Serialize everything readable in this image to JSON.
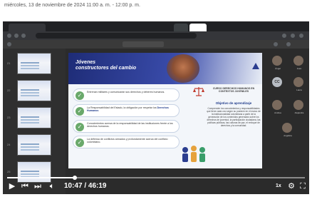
{
  "document": {
    "date_line": "miércoles, 13 de noviembre de 2024 11:00 a. m. - 12:00 p. m."
  },
  "player": {
    "progress_fraction": 0.228,
    "current_time": "10:47",
    "duration": "46:19",
    "time_separator": " / ",
    "speed": "1x"
  },
  "slide": {
    "title_line1": "Jóvenes",
    "title_line2": "constructores del cambio",
    "bullets": [
      {
        "text": "Entrenan militares y comunicarán sus derechos y deberes humanos.",
        "highlight": ""
      },
      {
        "text": "La Responsabilidad del Estado, la obligación por respetar los",
        "highlight": "Derechos Humanos"
      },
      {
        "text": "Conocimientos acerca de la responsabilidad de las instituciones frente a los derechos humanos.",
        "highlight": ""
      },
      {
        "text": "La defensa de conflictos armados y profundamente acerca del conflicto colombiano.",
        "highlight": ""
      }
    ],
    "right_panel": {
      "title": "CURSO DERECHOS HUMANOS EN CONTEXTOS JUVENILES",
      "subtitle": "Objetivo de aprendizaje",
      "body": "Comprender los conocimientos y responsabilidades que tiene cada uno según su posición en el marco de la institucionalidad colombiana a partir de la generación de los contenidos generados sobre los derechos de juventud, la participación ciudadana, las políticas públicas, las culturas de paz, el enfoque de derechos y la comunidad."
    }
  },
  "thumbnails": [
    {
      "number": "21"
    },
    {
      "number": "22"
    },
    {
      "number": "23"
    },
    {
      "number": "24"
    },
    {
      "number": "25"
    }
  ],
  "participants": [
    {
      "initials": "",
      "name": "Ángel"
    },
    {
      "initials": "",
      "name": "Juan"
    },
    {
      "initials": "CC",
      "name": ""
    },
    {
      "initials": "",
      "name": "Laura"
    },
    {
      "initials": "",
      "name": "Andrea"
    },
    {
      "initials": "",
      "name": "Alejandra"
    },
    {
      "initials": "",
      "name": "Angélica"
    }
  ]
}
